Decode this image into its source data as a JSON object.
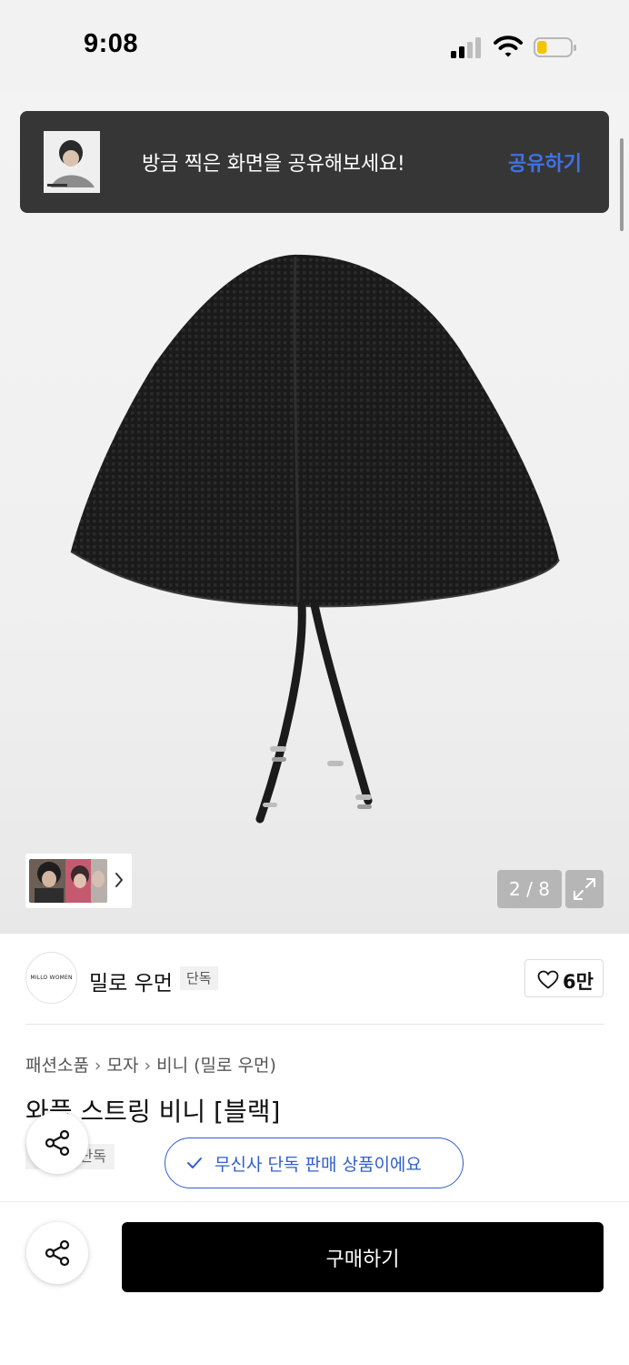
{
  "status_bar": {
    "time": "9:08",
    "battery_level": 0.3,
    "battery_color": "#f5c400"
  },
  "toast": {
    "message": "방금 찍은 화면을 공유해보세요!",
    "action_label": "공유하기",
    "action_color": "#3f72e6"
  },
  "gallery": {
    "pager_text": "2 / 8",
    "current": 2,
    "total": 8
  },
  "brand": {
    "logo_text": "MILLO WOMEN",
    "name": "밀로 우먼",
    "badge": "단독",
    "likes": "6만"
  },
  "product": {
    "breadcrumb": [
      "패션소품",
      "모자",
      "비니 (밀로 우먼)"
    ],
    "title": "와플 스트링 비니 [블랙]",
    "tag": "단독",
    "exclusive_notice": "무신사 단독 판매 상품이에요",
    "exclusive_color": "#2f5fcf"
  },
  "bottom_bar": {
    "buy_label": "구매하기"
  },
  "icons": {
    "signal": "signal-icon",
    "wifi": "wifi-icon",
    "battery": "battery-icon",
    "share": "share-icon",
    "heart": "heart-icon",
    "expand": "expand-icon",
    "chevron": "chevron-right-icon",
    "check": "check-icon"
  }
}
